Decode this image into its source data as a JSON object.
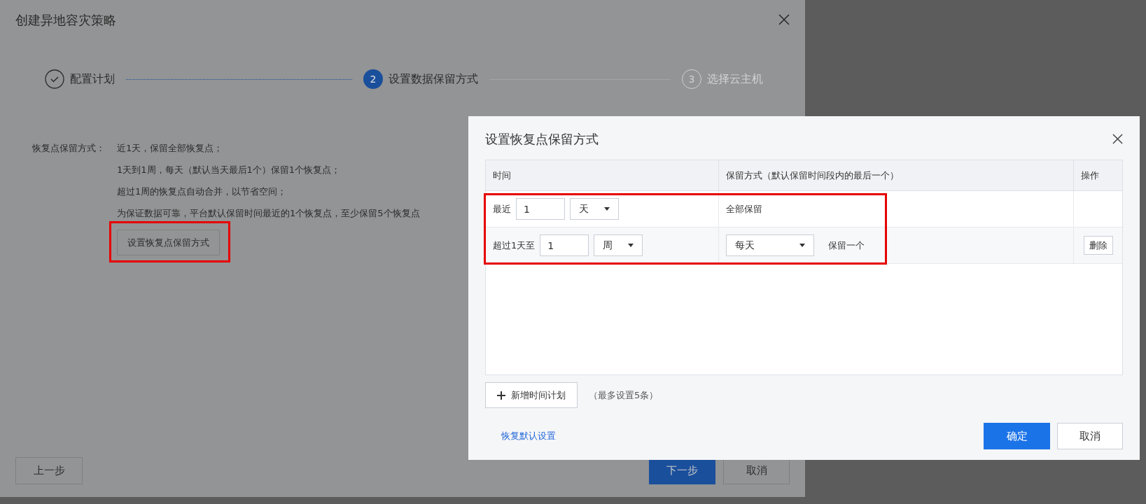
{
  "dialog": {
    "title": "创建异地容灾策略",
    "steps": [
      {
        "label": "配置计划",
        "done": true,
        "selected": false
      },
      {
        "index": "2",
        "label": "设置数据保留方式",
        "done": false,
        "selected": true
      },
      {
        "index": "3",
        "label": "选择云主机",
        "done": false,
        "selected": false
      }
    ],
    "retention": {
      "label": "恢复点保留方式：",
      "lines": [
        "近1天，保留全部恢复点；",
        "1天到1周，每天（默认当天最后1个）保留1个恢复点；",
        "超过1周的恢复点自动合并，以节省空间；",
        "为保证数据可靠，平台默认保留时间最近的1个恢复点，至少保留5个恢复点"
      ],
      "button": "设置恢复点保留方式",
      "highlighted": true
    },
    "footer": {
      "prev": "上一步",
      "next": "下一步",
      "cancel": "取消"
    }
  },
  "modal": {
    "title": "设置恢复点保留方式",
    "table": {
      "columns": [
        "时间",
        "保留方式（默认保留时间段内的最后一个）",
        "操作"
      ],
      "rows": [
        {
          "kind": "all",
          "prefix": "最近",
          "value": "1",
          "unit": "天",
          "retain": "全部保留"
        },
        {
          "kind": "periodic",
          "prefix": "超过1天至",
          "value": "1",
          "unit": "周",
          "frequency": "每天",
          "retain": "保留一个",
          "action": "删除"
        }
      ],
      "highlighted": true
    },
    "add_button": "新增时间计划",
    "add_note": "（最多设置5条）",
    "reset_link": "恢复默认设置",
    "ok": "确定",
    "cancel": "取消"
  }
}
